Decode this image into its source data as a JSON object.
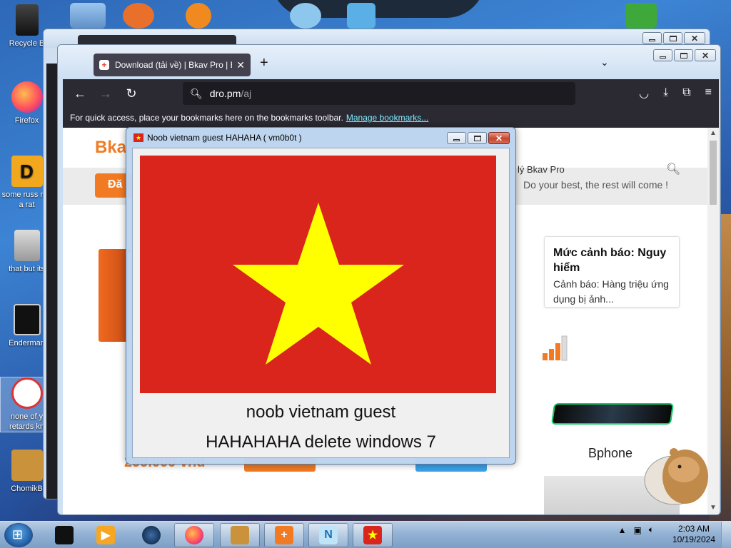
{
  "desktop": {
    "icons": [
      {
        "label": "Recycle B",
        "name": "recycle-bin"
      },
      {
        "label": "Firefox",
        "name": "firefox"
      },
      {
        "label": "some russ ran a rat",
        "name": "some-russ"
      },
      {
        "label": "that but its",
        "name": "that-but-its"
      },
      {
        "label": "Enderman",
        "name": "enderman"
      },
      {
        "label": "none of y retards kn",
        "name": "none-of-y"
      },
      {
        "label": "ChomikB",
        "name": "chomikbox"
      }
    ],
    "colors": {
      "wallpaper": "#2e68b8"
    }
  },
  "browser": {
    "tab_title": "Download (tải về) | Bkav Pro | Bk",
    "new_tab": "+",
    "tab_close": "✕",
    "list_tabs": "⌄",
    "back": "←",
    "forward": "→",
    "reload": "↻",
    "url_host": "dro.pm",
    "url_path": "/aj",
    "bookmarks_hint": "For quick access, place your bookmarks here on the bookmarks toolbar.",
    "manage_bookmarks": "Manage bookmarks..."
  },
  "page": {
    "logo": "Bka",
    "nav_text": "lý Bkav Pro",
    "slogan": "Do your best, the rest will come !",
    "register_btn": "Đă",
    "card_title": "Mức cảnh báo: Nguy hiểm",
    "card_body": "Cảnh báo: Hàng triệu ứng dụng bị ảnh...",
    "bphone": "Bphone",
    "price": "299.000 vnđ",
    "accent": "#f27a22"
  },
  "dialog": {
    "title": "Noob vietnam guest HAHAHA ( vm0b0t )",
    "line1": "noob vietnam guest",
    "line2": "HAHAHAHA delete windows 7",
    "flag_red": "#da251d",
    "flag_yellow": "#ffff00"
  },
  "taskbar": {
    "time": "2:03 AM",
    "date": "10/19/2024",
    "items": [
      "black-box",
      "media-player",
      "night-orb",
      "firefox",
      "chomikbox",
      "bkav",
      "n-app",
      "vietnam-flag-app"
    ]
  }
}
